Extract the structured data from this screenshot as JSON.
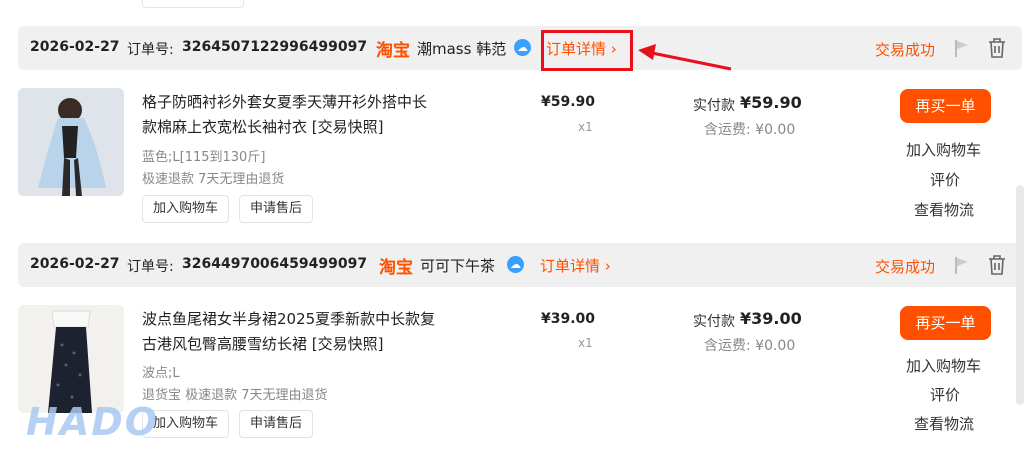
{
  "orders": [
    {
      "date": "2026-02-27",
      "order_label": "订单号:",
      "order_no": "3264507122996499097",
      "platform": "淘宝",
      "shop": "潮mass 韩范",
      "detail": "订单详情 ›",
      "status": "交易成功",
      "title_line1": "格子防晒衬衫外套女夏季天薄开衫外搭中长",
      "title_line2": "款棉麻上衣宽松长袖衬衣 [交易快照]",
      "spec": "蓝色;L[115到130斤]",
      "policy": "极速退款 7天无理由退货",
      "btn_cart": "加入购物车",
      "btn_after": "申请售后",
      "unit_price": "¥59.90",
      "qty": "x1",
      "paid_label": "实付款",
      "paid_amount": "¥59.90",
      "shipping": "含运费: ¥0.00",
      "rebuy": "再买一单",
      "add_cart": "加入购物车",
      "review": "评价",
      "logistics": "查看物流"
    },
    {
      "date": "2026-02-27",
      "order_label": "订单号:",
      "order_no": "3264497006459499097",
      "platform": "淘宝",
      "shop": "可可下午茶",
      "detail": "订单详情 ›",
      "status": "交易成功",
      "title_line1": "波点鱼尾裙女半身裙2025夏季新款中长款复",
      "title_line2": "古港风包臀高腰雪纺长裙 [交易快照]",
      "spec": "波点;L",
      "policy": "退货宝 极速退款 7天无理由退货",
      "btn_cart": "加入购物车",
      "btn_after": "申请售后",
      "unit_price": "¥39.00",
      "qty": "x1",
      "paid_label": "实付款",
      "paid_amount": "¥39.00",
      "shipping": "含运费: ¥0.00",
      "rebuy": "再买一单",
      "add_cart": "加入购物车",
      "review": "评价",
      "logistics": "查看物流"
    }
  ],
  "watermark": "HADO",
  "colors": {
    "accent": "#ff5000",
    "annotation": "#e8101a",
    "header_bg": "#f0f0f0"
  },
  "icons": [
    "wangwang-icon",
    "flag-icon",
    "trash-icon"
  ]
}
